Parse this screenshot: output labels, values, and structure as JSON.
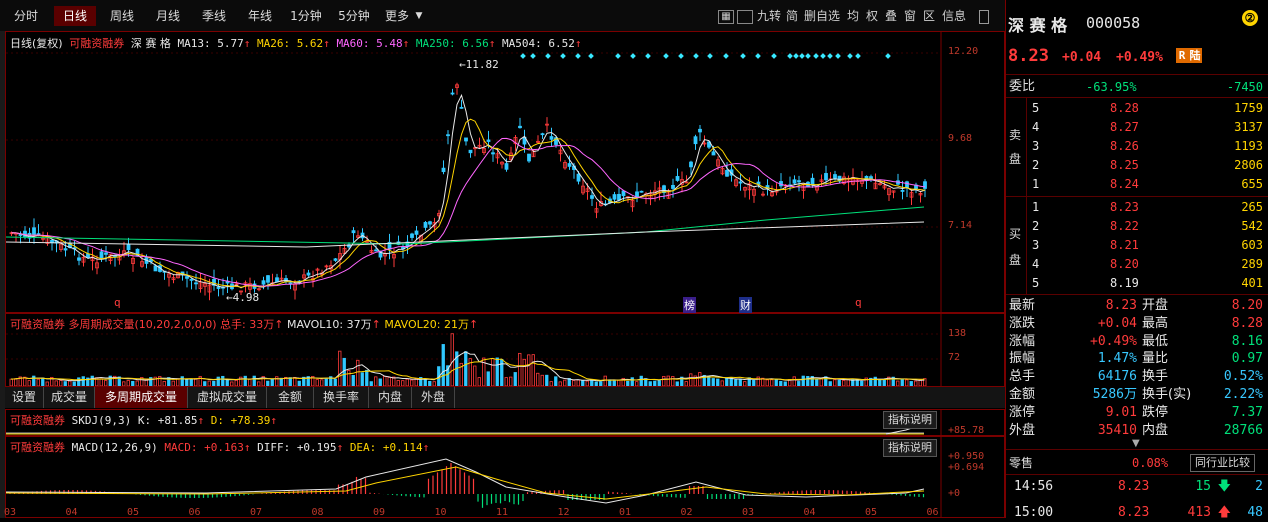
{
  "toolbar": {
    "tabs": [
      "分时",
      "日线",
      "周线",
      "月线",
      "季线",
      "年线",
      "1分钟",
      "5分钟",
      "更多"
    ],
    "more_arrow": "▼",
    "tools": [
      "九转",
      "简",
      "删自选",
      "均",
      "权",
      "叠",
      "窗",
      "区",
      "信息"
    ],
    "grid_icon": "▦"
  },
  "main_chart": {
    "legend_prefix": "日线(复权)",
    "margin_tag": "可融资融券",
    "stock_name": "深 赛 格",
    "ma": [
      {
        "label": "MA13: 5.77",
        "color": "#e8e8e8"
      },
      {
        "label": "MA26: 5.62",
        "color": "#ffd400"
      },
      {
        "label": "MA60: 5.48",
        "color": "#ff66ff"
      },
      {
        "label": "MA250: 6.56",
        "color": "#00e07a"
      },
      {
        "label": "MA504: 6.52",
        "color": "#e8e8e8"
      }
    ],
    "axis_labels": [
      "12.20",
      "9.68",
      "7.14"
    ],
    "high_label": "11.82",
    "low_label": "4.98",
    "bottom_marks": [
      "q",
      "榜",
      "财",
      "q"
    ]
  },
  "volume_chart": {
    "legend": "可融资融券 多周期成交量(10,20,2,0,0,0) 总手: 33万",
    "mavol10": "MAVOL10: 37万",
    "mavol20": "MAVOL20: 21万",
    "axis_labels": [
      "138",
      "72"
    ]
  },
  "subtabs": [
    "设置",
    "成交量",
    "多周期成交量",
    "虚拟成交量",
    "金额",
    "换手率",
    "内盘",
    "外盘"
  ],
  "skdj_chart": {
    "legend_tag": "可融资融券",
    "legend": "SKDJ(9,3) K: +81.85",
    "d_value": "D: +78.39",
    "explain": "指标说明",
    "axis_label": "+85.78"
  },
  "macd_chart": {
    "legend_tag": "可融资融券",
    "legend": "MACD(12,26,9)",
    "macd_value": "MACD: +0.163",
    "diff_value": "DIFF: +0.195",
    "dea_value": "DEA: +0.114",
    "explain": "指标说明",
    "axis_labels": [
      "+0.950",
      "+0.694",
      "+0"
    ],
    "x_months": [
      "03",
      "04",
      "05",
      "06",
      "07",
      "08",
      "09",
      "10",
      "11",
      "12",
      "01",
      "02",
      "03",
      "04",
      "05",
      "06"
    ]
  },
  "quote": {
    "name": "深 赛 格",
    "code": "000058",
    "badge": "②",
    "price": "8.23",
    "change": "+0.04",
    "change_pct": "+0.49%",
    "tag1": "R",
    "tag2": "陆",
    "weibi_label": "委比",
    "weibi_pct": "-63.95%",
    "weibi_val": "-7450",
    "sell_label": [
      "卖",
      "盘"
    ],
    "buy_label": [
      "买",
      "盘"
    ],
    "asks": [
      {
        "lvl": "5",
        "price": "8.28",
        "vol": "1759"
      },
      {
        "lvl": "4",
        "price": "8.27",
        "vol": "3137"
      },
      {
        "lvl": "3",
        "price": "8.26",
        "vol": "1193"
      },
      {
        "lvl": "2",
        "price": "8.25",
        "vol": "2806"
      },
      {
        "lvl": "1",
        "price": "8.24",
        "vol": "655"
      }
    ],
    "bids": [
      {
        "lvl": "1",
        "price": "8.23",
        "vol": "265"
      },
      {
        "lvl": "2",
        "price": "8.22",
        "vol": "542"
      },
      {
        "lvl": "3",
        "price": "8.21",
        "vol": "603"
      },
      {
        "lvl": "4",
        "price": "8.20",
        "vol": "289"
      },
      {
        "lvl": "5",
        "price": "8.19",
        "vol": "401"
      }
    ],
    "stats": [
      {
        "l1": "最新",
        "v1": "8.23",
        "c1": "red",
        "l2": "开盘",
        "v2": "8.20",
        "c2": "red"
      },
      {
        "l1": "涨跌",
        "v1": "+0.04",
        "c1": "red",
        "l2": "最高",
        "v2": "8.28",
        "c2": "red"
      },
      {
        "l1": "涨幅",
        "v1": "+0.49%",
        "c1": "red",
        "l2": "最低",
        "v2": "8.16",
        "c2": "green"
      },
      {
        "l1": "振幅",
        "v1": "1.47%",
        "c1": "cyan",
        "l2": "量比",
        "v2": "0.97",
        "c2": "green"
      },
      {
        "l1": "总手",
        "v1": "64176",
        "c1": "cyan",
        "l2": "换手",
        "v2": "0.52%",
        "c2": "cyan"
      },
      {
        "l1": "金额",
        "v1": "5286万",
        "c1": "cyan",
        "l2": "换手(实)",
        "v2": "2.22%",
        "c2": "cyan"
      },
      {
        "l1": "涨停",
        "v1": "9.01",
        "c1": "red",
        "l2": "跌停",
        "v2": "7.37",
        "c2": "green"
      },
      {
        "l1": "外盘",
        "v1": "35410",
        "c1": "red",
        "l2": "内盘",
        "v2": "28766",
        "c2": "green"
      }
    ],
    "retail_label": "零售",
    "retail_pct": "0.08%",
    "industry_btn": "同行业比较",
    "ticks": [
      {
        "time": "14:56",
        "price": "8.23",
        "vol": "15",
        "dir": "down",
        "n": "2"
      },
      {
        "time": "15:00",
        "price": "8.23",
        "vol": "413",
        "dir": "up",
        "n": "48"
      }
    ]
  }
}
